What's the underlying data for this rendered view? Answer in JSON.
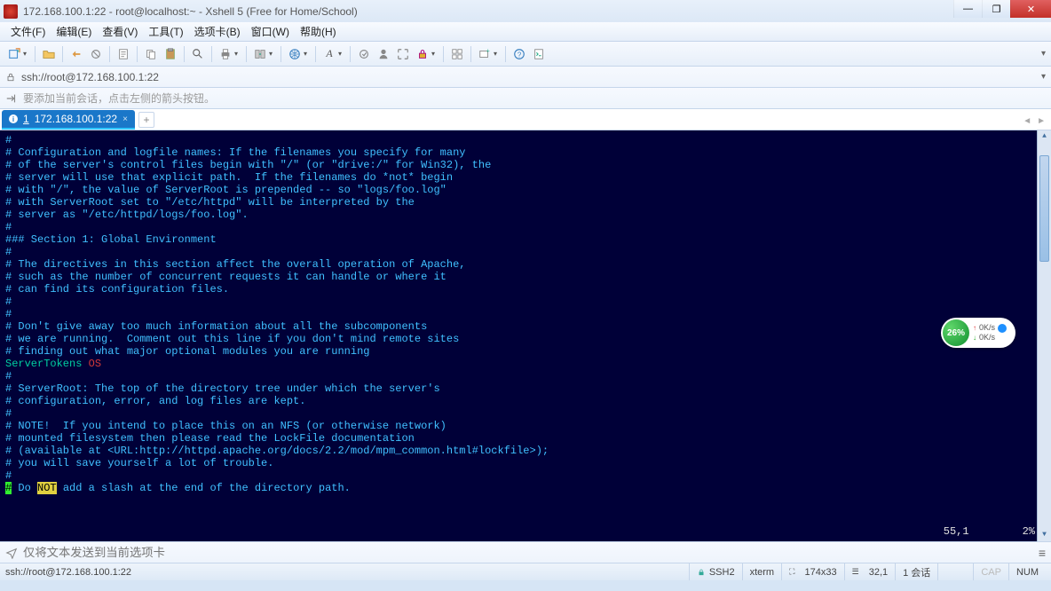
{
  "window": {
    "title": "172.168.100.1:22 - root@localhost:~ - Xshell 5 (Free for Home/School)"
  },
  "menu": {
    "file": "文件(F)",
    "edit": "编辑(E)",
    "view": "查看(V)",
    "tools": "工具(T)",
    "tabs": "选项卡(B)",
    "window": "窗口(W)",
    "help": "帮助(H)"
  },
  "address": {
    "url": "ssh://root@172.168.100.1:22"
  },
  "hint": {
    "text": "要添加当前会话，点击左侧的箭头按钮。"
  },
  "tab": {
    "index": "1",
    "label": "172.168.100.1:22"
  },
  "terminal_lines": [
    {
      "t": "#"
    },
    {
      "t": "# Configuration and logfile names: If the filenames you specify for many"
    },
    {
      "t": "# of the server's control files begin with \"/\" (or \"drive:/\" for Win32), the"
    },
    {
      "t": "# server will use that explicit path.  If the filenames do *not* begin"
    },
    {
      "t": "# with \"/\", the value of ServerRoot is prepended -- so \"logs/foo.log\""
    },
    {
      "t": "# with ServerRoot set to \"/etc/httpd\" will be interpreted by the"
    },
    {
      "t": "# server as \"/etc/httpd/logs/foo.log\"."
    },
    {
      "t": "#"
    },
    {
      "t": ""
    },
    {
      "t": "### Section 1: Global Environment"
    },
    {
      "t": "#"
    },
    {
      "t": "# The directives in this section affect the overall operation of Apache,"
    },
    {
      "t": "# such as the number of concurrent requests it can handle or where it"
    },
    {
      "t": "# can find its configuration files."
    },
    {
      "t": "#"
    },
    {
      "t": ""
    },
    {
      "t": "#"
    },
    {
      "t": "# Don't give away too much information about all the subcomponents"
    },
    {
      "t": "# we are running.  Comment out this line if you don't mind remote sites"
    },
    {
      "t": "# finding out what major optional modules you are running"
    },
    {
      "kw": "ServerTokens ",
      "val": "OS"
    },
    {
      "t": ""
    },
    {
      "t": "#"
    },
    {
      "t": "# ServerRoot: The top of the directory tree under which the server's"
    },
    {
      "t": "# configuration, error, and log files are kept."
    },
    {
      "t": "#"
    },
    {
      "t": "# NOTE!  If you intend to place this on an NFS (or otherwise network)"
    },
    {
      "t": "# mounted filesystem then please read the LockFile documentation"
    },
    {
      "t": "# (available at <URL:http://httpd.apache.org/docs/2.2/mod/mpm_common.html#lockfile>);"
    },
    {
      "t": "# you will save yourself a lot of trouble."
    },
    {
      "t": "#"
    }
  ],
  "cursor_line": {
    "caret": "#",
    "pre": " Do ",
    "hi": "NOT",
    "post": " add a slash at the end of the directory path."
  },
  "vim": {
    "pos": "55,1",
    "pct": "2%"
  },
  "widget": {
    "pct": "26%",
    "up": "0K/s",
    "down": "0K/s"
  },
  "send": {
    "placeholder": "仅将文本发送到当前选项卡"
  },
  "status": {
    "addr": "ssh://root@172.168.100.1:22",
    "proto": "SSH2",
    "term": "xterm",
    "size": "174x33",
    "rc": "32,1",
    "sessions": "1 会话",
    "cap": "CAP",
    "num": "NUM"
  }
}
